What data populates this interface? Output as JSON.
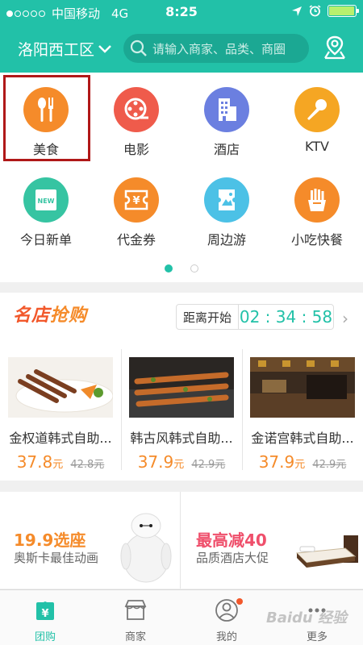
{
  "status_bar": {
    "carrier": "中国移动",
    "network": "4G",
    "time": "8:25"
  },
  "header": {
    "city": "洛阳西工区",
    "search_placeholder": "请输入商家、品类、商圈"
  },
  "categories": [
    {
      "label": "美食",
      "icon": "fork-spoon-icon",
      "color": "#f58b2a"
    },
    {
      "label": "电影",
      "icon": "film-reel-icon",
      "color": "#ef5b4b"
    },
    {
      "label": "酒店",
      "icon": "hotel-building-icon",
      "color": "#6b7fe0"
    },
    {
      "label": "KTV",
      "icon": "microphone-icon",
      "color": "#f5a623"
    },
    {
      "label": "今日新单",
      "icon": "new-tag-icon",
      "color": "#36c4a2"
    },
    {
      "label": "代金券",
      "icon": "voucher-icon",
      "color": "#f58b2a"
    },
    {
      "label": "周边游",
      "icon": "travel-ticket-icon",
      "color": "#4cc1e6"
    },
    {
      "label": "小吃快餐",
      "icon": "fries-icon",
      "color": "#f58b2a"
    }
  ],
  "flash_sale": {
    "title_part1": "名店",
    "title_part2": "抢购",
    "countdown_label": "距离开始",
    "countdown": "02 : 34 : 58",
    "deals": [
      {
        "name": "金权道韩式自助...",
        "price": "37.8",
        "unit": "元",
        "old_price": "42.8元"
      },
      {
        "name": "韩古风韩式自助...",
        "price": "37.9",
        "unit": "元",
        "old_price": "42.9元"
      },
      {
        "name": "金诺宫韩式自助...",
        "price": "37.9",
        "unit": "元",
        "old_price": "42.9元"
      }
    ]
  },
  "promos": [
    {
      "title": "19.9选座",
      "subtitle": "奥斯卡最佳动画",
      "color": "#f58b2a"
    },
    {
      "title": "最高减40",
      "subtitle": "品质酒店大促",
      "color": "#ef4f6b"
    }
  ],
  "tabbar": [
    {
      "label": "团购",
      "active": true
    },
    {
      "label": "商家",
      "active": false
    },
    {
      "label": "我的",
      "active": false
    },
    {
      "label": "更多",
      "active": false
    }
  ],
  "watermark": "Baidu 经验"
}
